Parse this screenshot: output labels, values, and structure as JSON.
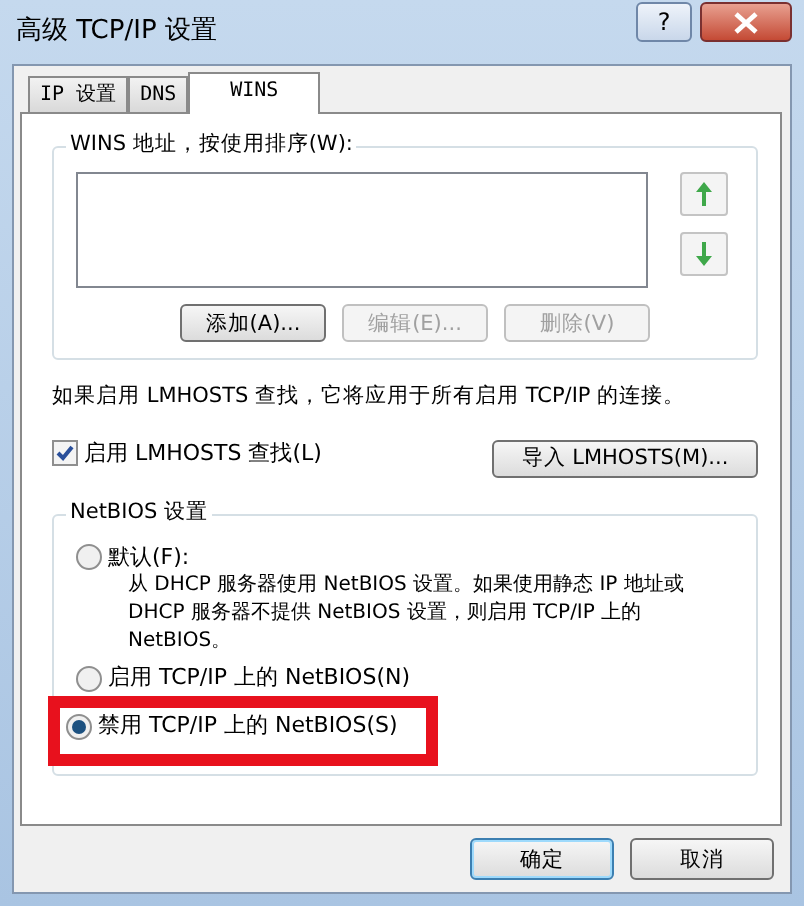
{
  "window": {
    "title": "高级 TCP/IP 设置",
    "help_button": "?"
  },
  "tabs": [
    {
      "label": "IP 设置",
      "selected": false
    },
    {
      "label": "DNS",
      "selected": false
    },
    {
      "label": "WINS",
      "selected": true
    }
  ],
  "wins_group": {
    "legend": "WINS 地址，按使用排序(W):",
    "buttons": [
      {
        "label": "添加(A)...",
        "disabled": false
      },
      {
        "label": "编辑(E)...",
        "disabled": true
      },
      {
        "label": "删除(V)",
        "disabled": true
      }
    ]
  },
  "info_text": "如果启用 LMHOSTS 查找，它将应用于所有启用 TCP/IP 的连接。",
  "lmhosts_checkbox": {
    "label": "启用 LMHOSTS 查找(L)",
    "checked": true
  },
  "import_button": "导入 LMHOSTS(M)...",
  "netbios_group": {
    "legend": "NetBIOS 设置",
    "options": [
      {
        "label": "默认(F):",
        "description": "从 DHCP 服务器使用 NetBIOS 设置。如果使用静态 IP 地址或 DHCP 服务器不提供 NetBIOS 设置，则启用 TCP/IP 上的 NetBIOS。",
        "selected": false,
        "highlighted": false
      },
      {
        "label": "启用 TCP/IP 上的 NetBIOS(N)",
        "selected": false,
        "highlighted": false
      },
      {
        "label": "禁用 TCP/IP 上的 NetBIOS(S)",
        "selected": true,
        "highlighted": true
      }
    ]
  },
  "footer_buttons": [
    {
      "label": "确定",
      "default": true
    },
    {
      "label": "取消",
      "default": false
    }
  ]
}
